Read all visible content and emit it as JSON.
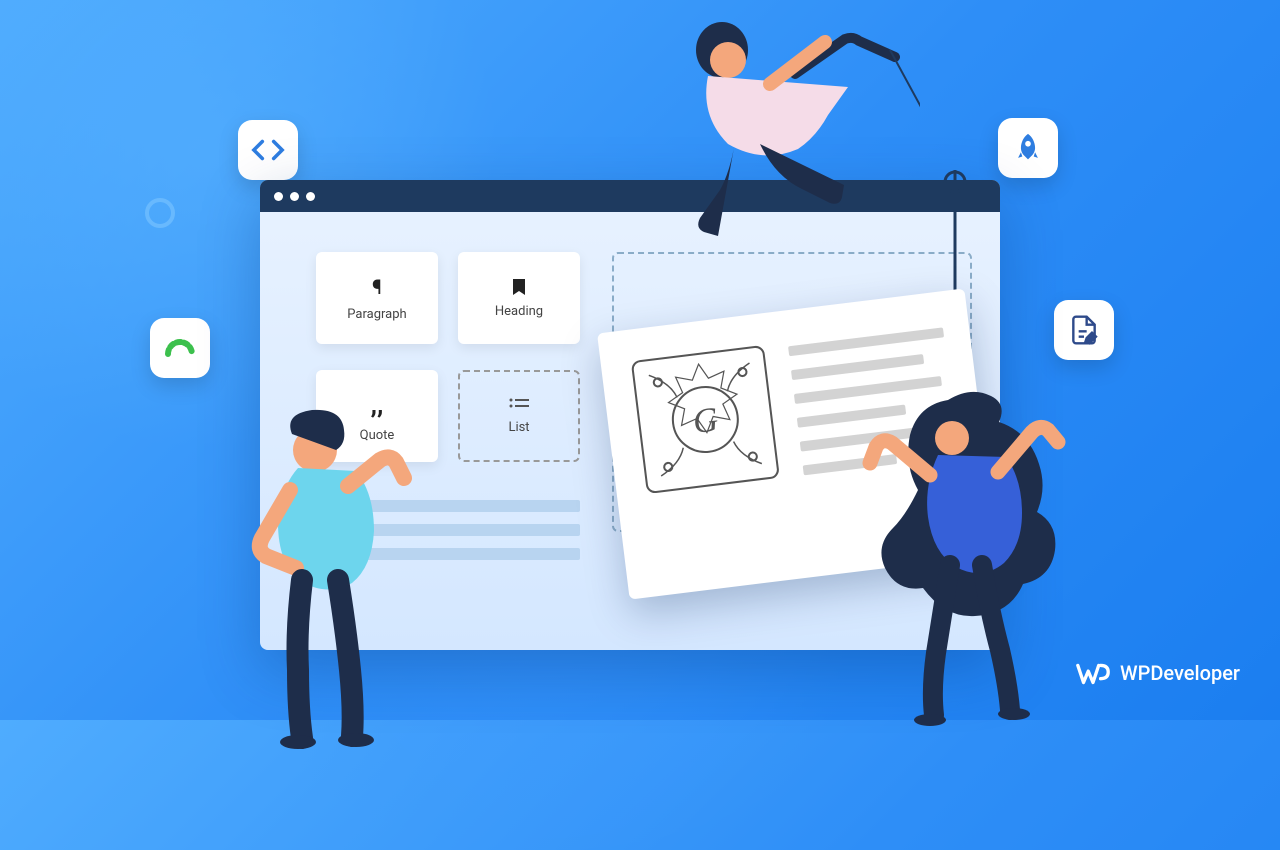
{
  "blocks": {
    "paragraph": "Paragraph",
    "heading": "Heading",
    "quote": "Quote",
    "list": "List"
  },
  "brand": "WPDeveloper",
  "icons": {
    "code": "code-icon",
    "gauge": "gauge-icon",
    "rocket": "rocket-icon",
    "doc": "doc-edit-icon"
  },
  "colors": {
    "bg_start": "#4facfe",
    "bg_end": "#1b7ef0",
    "browser_bar": "#1e3a5f",
    "gauge_green": "#3cc04d",
    "rocket_blue": "#2e7de0",
    "doc_blue": "#2e4a8a"
  }
}
